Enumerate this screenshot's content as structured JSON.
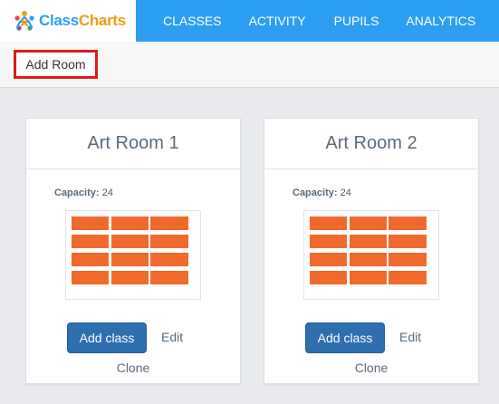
{
  "header": {
    "logo_class": "Class",
    "logo_charts": "Charts",
    "nav": [
      "CLASSES",
      "ACTIVITY",
      "PUPILS",
      "ANALYTICS"
    ],
    "accent_color": "#2d9ff0"
  },
  "toolbar": {
    "add_room_label": "Add Room"
  },
  "rooms": [
    {
      "name": "Art Room 1",
      "capacity_label": "Capacity:",
      "capacity": "24",
      "add_class_label": "Add class",
      "edit_label": "Edit",
      "clone_label": "Clone"
    },
    {
      "name": "Art Room 2",
      "capacity_label": "Capacity:",
      "capacity": "24",
      "add_class_label": "Add class",
      "edit_label": "Edit",
      "clone_label": "Clone"
    }
  ],
  "desk_color": "#f06a2b",
  "button_color": "#2e6fb0"
}
